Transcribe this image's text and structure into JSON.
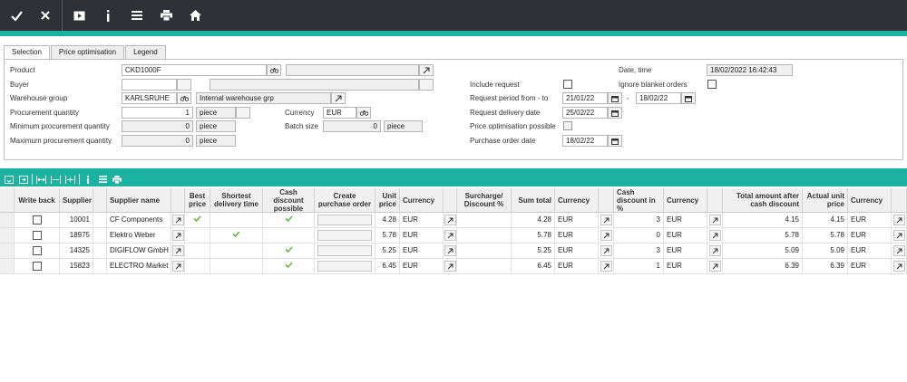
{
  "toolbar": {
    "buttons": [
      "check-icon",
      "close-icon",
      "play-icon",
      "info-icon",
      "menu-icon",
      "print-icon",
      "home-icon"
    ]
  },
  "tabs": [
    "Selection",
    "Price optimisation",
    "Legend"
  ],
  "form": {
    "product_label": "Product",
    "product_value": "CKD1000F",
    "buyer_label": "Buyer",
    "warehouse_group_label": "Warehouse group",
    "warehouse_group_value": "KARLSRUHE",
    "warehouse_group_desc": "Internal warehouse grp",
    "procurement_qty_label": "Procurement quantity",
    "procurement_qty_value": "1",
    "procurement_qty_unit": "piece",
    "min_qty_label": "Minimum procurement quantity",
    "min_qty_value": "0",
    "min_qty_unit": "piece",
    "max_qty_label": "Maximum procurement quantity",
    "max_qty_value": "0",
    "max_qty_unit": "piece",
    "currency_label": "Currency",
    "currency_value": "EUR",
    "batch_size_label": "Batch size",
    "batch_size_value": "0",
    "batch_size_unit": "piece",
    "include_request_label": "Include request",
    "include_request_checked": false,
    "request_period_label": "Request period from - to",
    "request_period_from": "21/01/22",
    "request_period_dash": "-",
    "request_period_to": "18/02/22",
    "request_delivery_label": "Request delivery date",
    "request_delivery_value": "25/02/22",
    "price_opt_possible_label": "Price optimisation possible",
    "price_opt_possible_checked": false,
    "purchase_order_date_label": "Purchase order date",
    "purchase_order_date_value": "18/02/22",
    "date_time_label": "Date, time",
    "date_time_value": "18/02/2022 16:42:43",
    "ignore_blanket_label": "Ignore blanket orders",
    "ignore_blanket_checked": false
  },
  "grid_toolbar": [
    "save-layout-icon",
    "export-icon",
    "column-width-icon",
    "column-fit-icon",
    "column-auto-icon",
    "info-icon",
    "menu-icon",
    "print-icon"
  ],
  "table": {
    "headers": {
      "write_back": "Write back",
      "supplier": "Supplier",
      "supplier_name": "Supplier name",
      "best_price": "Best price",
      "shortest_delivery": "Shortest delivery time",
      "cash_discount_possible": "Cash discount possible",
      "create_po": "Create purchase order",
      "unit_price": "Unit price",
      "currency1": "Currency",
      "surcharge": "Surcharge/ Discount %",
      "sum_total": "Sum total",
      "currency2": "Currency",
      "cash_discount_pct": "Cash discount in %",
      "currency3": "Currency",
      "total_after_discount": "Total amount after cash discount",
      "actual_unit_price": "Actual unit price",
      "currency4": "Currency"
    },
    "rows": [
      {
        "supplier": "10001",
        "name": "CF Components",
        "best_price": true,
        "shortest": false,
        "cash_discount": true,
        "unit_price": "4.28",
        "cur1": "EUR",
        "sum_total": "4.28",
        "cur2": "EUR",
        "discount_pct": "3",
        "cur3": "EUR",
        "total_after": "4.15",
        "actual": "4.15",
        "cur4": "EUR"
      },
      {
        "supplier": "18975",
        "name": "Elektro Weber",
        "best_price": false,
        "shortest": true,
        "cash_discount": false,
        "unit_price": "5.78",
        "cur1": "EUR",
        "sum_total": "5.78",
        "cur2": "EUR",
        "discount_pct": "0",
        "cur3": "EUR",
        "total_after": "5.78",
        "actual": "5.78",
        "cur4": "EUR"
      },
      {
        "supplier": "14325",
        "name": "DIGIFLOW GmbH",
        "best_price": false,
        "shortest": false,
        "cash_discount": true,
        "unit_price": "5.25",
        "cur1": "EUR",
        "sum_total": "5.25",
        "cur2": "EUR",
        "discount_pct": "3",
        "cur3": "EUR",
        "total_after": "5.09",
        "actual": "5.09",
        "cur4": "EUR"
      },
      {
        "supplier": "15823",
        "name": "ELECTRO Market",
        "best_price": false,
        "shortest": false,
        "cash_discount": true,
        "unit_price": "6.45",
        "cur1": "EUR",
        "sum_total": "6.45",
        "cur2": "EUR",
        "discount_pct": "1",
        "cur3": "EUR",
        "total_after": "6.39",
        "actual": "6.39",
        "cur4": "EUR"
      }
    ]
  },
  "colors": {
    "topbar": "#2e3236",
    "accent": "#1bb2a1",
    "check_green": "#6cb33f"
  }
}
